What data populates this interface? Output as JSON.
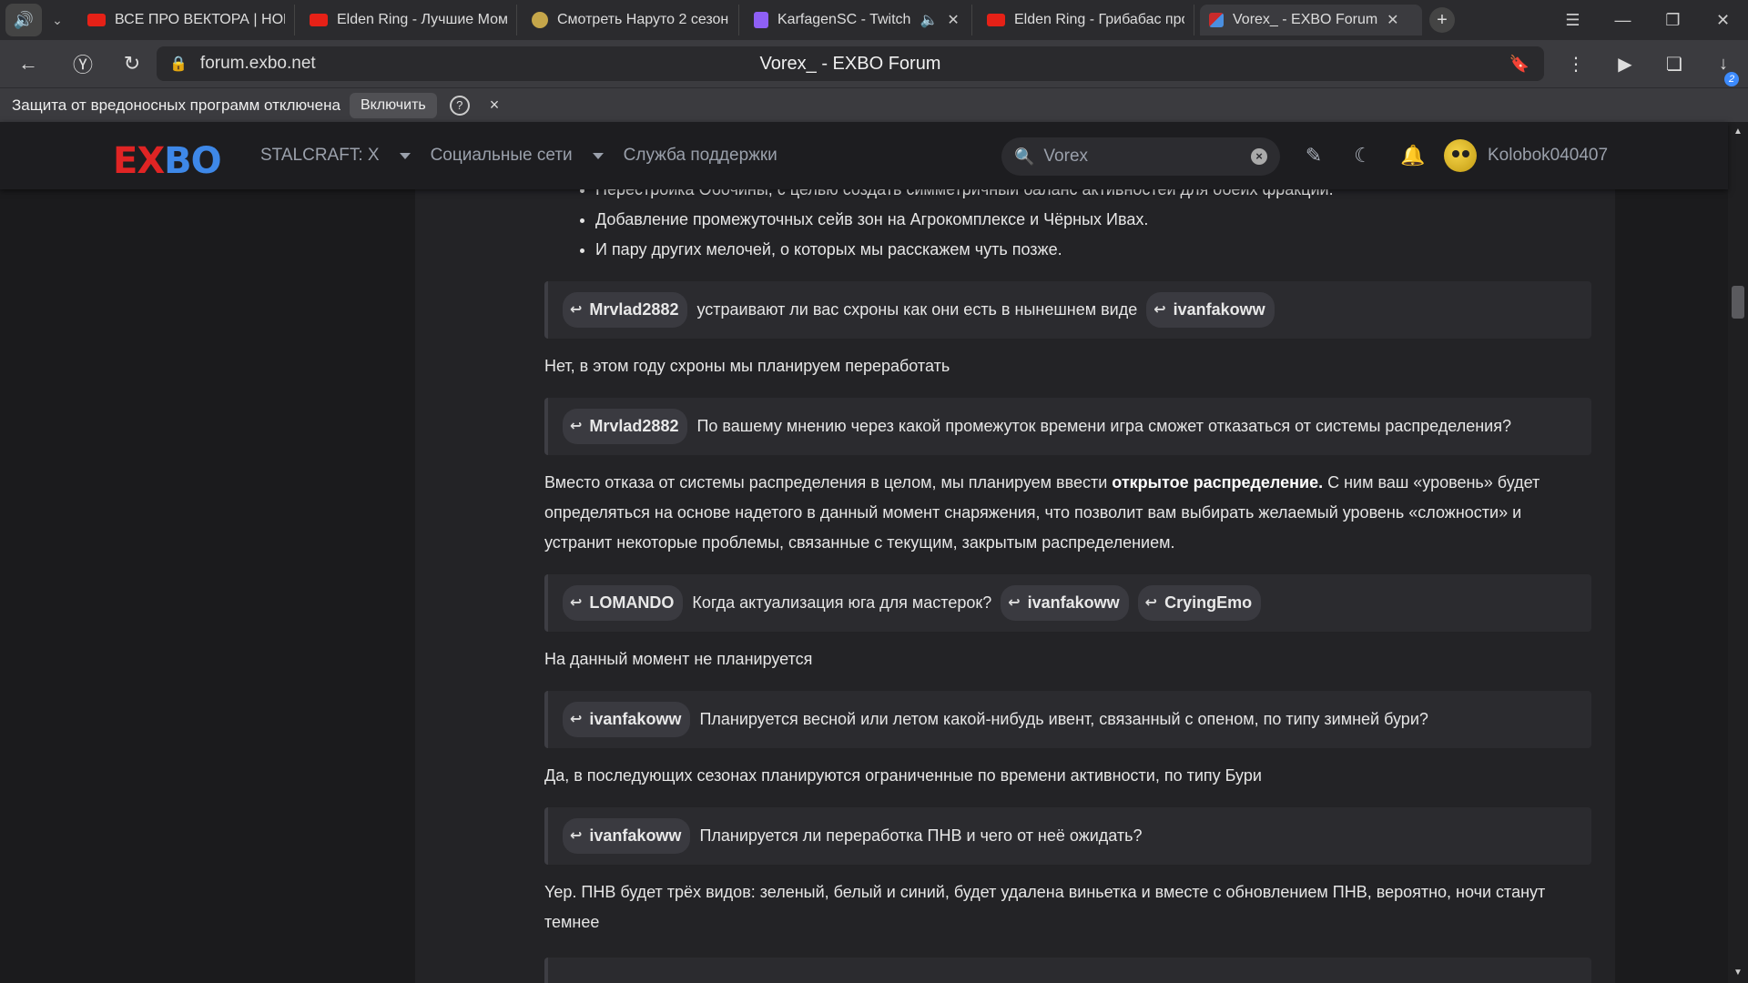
{
  "browser": {
    "tabs": [
      {
        "title": "ВСЕ ПРО ВЕКТОРА | НОВ",
        "favicon": "youtube-icon",
        "active": false
      },
      {
        "title": "Elden Ring - Лучшие Мом",
        "favicon": "youtube-icon",
        "active": false
      },
      {
        "title": "Смотреть Наруто 2 сезон",
        "favicon": "site-icon",
        "active": false
      },
      {
        "title": "KarfagenSC - Twitch",
        "favicon": "twitch-icon",
        "active": false
      },
      {
        "title": "Elden Ring - Грибабас про",
        "favicon": "youtube-icon",
        "active": false
      },
      {
        "title": "Vorex_ - EXBO Forum",
        "favicon": "exbo-icon",
        "active": true
      }
    ],
    "url": "forum.exbo.net",
    "page_title": "Vorex_ - EXBO Forum",
    "downloads_badge": "2"
  },
  "infobar": {
    "message": "Защита от вредоносных программ отключена",
    "enable_label": "Включить",
    "help_label": "?",
    "close_label": "×"
  },
  "site": {
    "logo_ex": "EX",
    "logo_bo": "BO",
    "menu": [
      {
        "label": "STALCRAFT: X"
      },
      {
        "label": "Социальные сети"
      },
      {
        "label": "Служба поддержки"
      }
    ],
    "search_value": "Vorex",
    "username": "Kolobok040407"
  },
  "post": {
    "bullets": [
      "Перестройка Обочины, с целью создать симметричный баланс активностей для обеих фракций.",
      "Добавление промежуточных сейв зон на Агрокомплексе и Чёрных Ивах.",
      "И пару других мелочей, о которых мы расскажем чуть позже."
    ],
    "qa": [
      {
        "mentions_before": [
          "Mrvlad2882"
        ],
        "question": "устраивают ли вас схроны как они есть в нынешнем виде",
        "mentions_after": [
          "ivanfakoww"
        ],
        "answer_plain": "Нет, в этом году схроны мы планируем переработать"
      },
      {
        "mentions_before": [
          "Mrvlad2882"
        ],
        "question": "По вашему мнению через какой промежуток времени игра сможет отказаться от системы распределения?",
        "mentions_after": [],
        "answer_pre": "Вместо отказа от системы распределения в целом, мы планируем ввести ",
        "answer_bold": "открытое распределение.",
        "answer_post": " С ним ваш «уровень» будет определяться на основе надетого в данный момент снаряжения, что позволит вам выбирать желаемый уровень «сложности» и устранит некоторые проблемы, связанные с текущим, закрытым распределением."
      },
      {
        "mentions_before": [
          "LOMANDO"
        ],
        "question": "Когда актуализация юга для мастерок?",
        "mentions_after": [
          "ivanfakoww",
          "CryingEmo"
        ],
        "answer_plain": "На данный момент не планируется"
      },
      {
        "mentions_before": [
          "ivanfakoww"
        ],
        "question": "Планируется весной или летом какой-нибудь ивент, связанный с опеном, по типу зимней бури?",
        "mentions_after": [],
        "answer_plain": "Да, в последующих сезонах планируются ограниченные по времени активности, по типу Бури"
      },
      {
        "mentions_before": [
          "ivanfakoww"
        ],
        "question": "Планируется ли переработка ПНВ и чего от неё ожидать?",
        "mentions_after": [],
        "answer_plain": "Yep. ПНВ будет трёх видов: зеленый, белый и синий, будет удалена виньетка и вместе с обновлением ПНВ, вероятно, ночи станут темнее"
      }
    ]
  },
  "colors": {
    "logo_red": "#e02424",
    "logo_blue": "#3e88e8",
    "background": "#1b1b1d",
    "post_background": "#232326",
    "quote_background": "#2b2b2f"
  }
}
